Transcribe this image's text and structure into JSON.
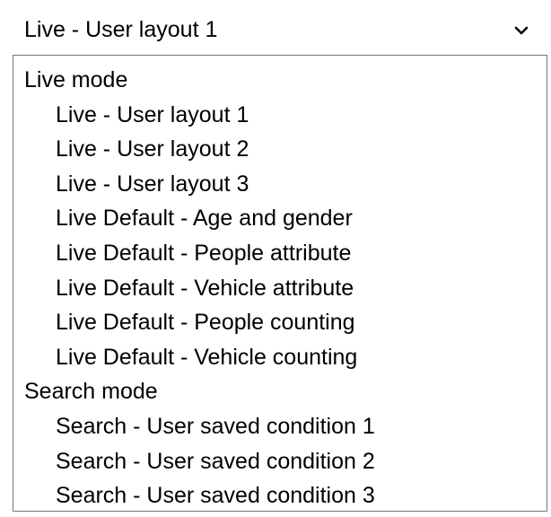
{
  "select": {
    "value": "Live - User layout 1"
  },
  "dropdown": {
    "groups": [
      {
        "label": "Live mode",
        "options": [
          "Live - User layout 1",
          "Live - User layout 2",
          "Live - User layout 3",
          "Live Default - Age and gender",
          "Live Default - People attribute",
          "Live Default - Vehicle attribute",
          "Live Default - People counting",
          "Live Default - Vehicle counting"
        ]
      },
      {
        "label": "Search mode",
        "options": [
          "Search - User saved condition 1",
          "Search - User saved condition 2",
          "Search - User saved condition 3"
        ]
      }
    ]
  },
  "icons": {
    "chevron": "chevron-down-icon"
  }
}
